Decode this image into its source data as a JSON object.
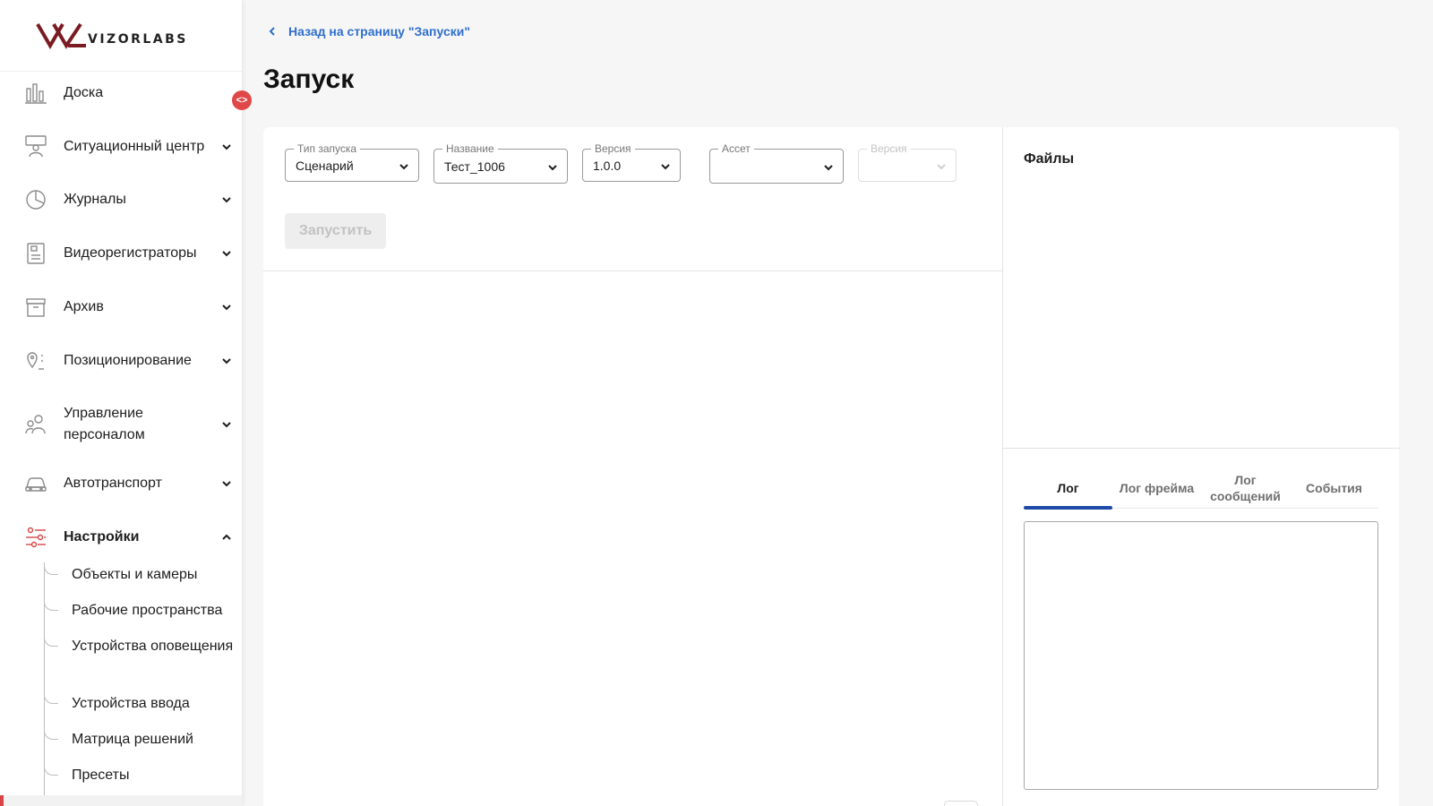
{
  "brand": {
    "name": "VIZORLABS",
    "accent": "#d84545",
    "dark_red": "#7a1b22"
  },
  "sidebar": {
    "items": [
      {
        "label": "Доска",
        "icon": "dashboard-chart-icon",
        "expandable": false
      },
      {
        "label": "Ситуационный центр",
        "icon": "situation-center-icon",
        "expandable": true
      },
      {
        "label": "Журналы",
        "icon": "pie-chart-icon",
        "expandable": true
      },
      {
        "label": "Видеорегистраторы",
        "icon": "video-recorder-icon",
        "expandable": true
      },
      {
        "label": "Архив",
        "icon": "archive-box-icon",
        "expandable": true
      },
      {
        "label": "Позиционирование",
        "icon": "location-pin-icon",
        "expandable": true
      },
      {
        "label": "Управление персоналом",
        "icon": "people-icon",
        "expandable": true
      },
      {
        "label": "Автотранспорт",
        "icon": "car-icon",
        "expandable": true
      },
      {
        "label": "Настройки",
        "icon": "settings-sliders-icon",
        "expandable": true,
        "expanded": true
      }
    ],
    "subitems": [
      {
        "label": "Объекты и камеры"
      },
      {
        "label": "Рабочие пространства"
      },
      {
        "label": "Устройства оповещения"
      },
      {
        "label": "Устройства ввода"
      },
      {
        "label": "Матрица решений"
      },
      {
        "label": "Пресеты"
      }
    ],
    "collapse_glyph": "<>"
  },
  "header": {
    "back_link": "Назад на страницу \"Запуски\"",
    "title": "Запуск"
  },
  "form": {
    "launch_type": {
      "label": "Тип запуска",
      "value": "Сценарий"
    },
    "name": {
      "label": "Название",
      "value": "Тест_1006"
    },
    "version": {
      "label": "Версия",
      "value": "1.0.0"
    },
    "asset": {
      "label": "Ассет",
      "value": ""
    },
    "asset_version": {
      "label": "Версия",
      "value": ""
    },
    "run_button": "Запустить"
  },
  "files": {
    "title": "Файлы"
  },
  "log_tabs": [
    {
      "label": "Лог",
      "active": true
    },
    {
      "label": "Лог фрейма",
      "active": false
    },
    {
      "label": "Лог сообщений",
      "active": false
    },
    {
      "label": "События",
      "active": false
    }
  ]
}
